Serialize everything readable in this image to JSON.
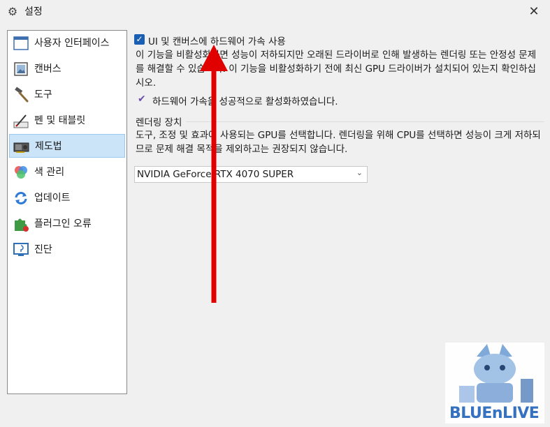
{
  "window": {
    "title": "설정",
    "close_glyph": "✕",
    "settings_icon": "gear-icon"
  },
  "sidebar": {
    "items": [
      {
        "label": "사용자 인터페이스",
        "icon": "window-icon",
        "selected": false
      },
      {
        "label": "캔버스",
        "icon": "image-icon",
        "selected": false
      },
      {
        "label": "도구",
        "icon": "hammer-icon",
        "selected": false
      },
      {
        "label": "펜 및 태블릿",
        "icon": "tablet-pen-icon",
        "selected": false
      },
      {
        "label": "제도법",
        "icon": "gpu-card-icon",
        "selected": true
      },
      {
        "label": "색 관리",
        "icon": "color-circles-icon",
        "selected": false
      },
      {
        "label": "업데이트",
        "icon": "refresh-icon",
        "selected": false
      },
      {
        "label": "플러그인 오류",
        "icon": "puzzle-icon",
        "selected": false
      },
      {
        "label": "진단",
        "icon": "diagnostics-icon",
        "selected": false
      }
    ]
  },
  "main": {
    "hw_accel": {
      "checked": true,
      "label": "UI 및 캔버스에 하드웨어 가속 사용",
      "description": "이 기능을 비활성화하면 성능이 저하되지만 오래된 드라이버로 인해 발생하는 렌더링 또는 안정성 문제를 해결할 수 있습니다. 이 기능을 비활성화하기 전에 최신 GPU 드라이버가 설치되어 있는지 확인하십시오.",
      "status": "하드웨어 가속을 성공적으로 활성화하였습니다."
    },
    "rendering": {
      "heading": "렌더링 장치",
      "description": "도구, 조정 및 효과에 사용되는 GPU를 선택합니다. 렌더링을 위해 CPU를 선택하면 성능이 크게 저하되므로 문제 해결 목적을 제외하고는 권장되지 않습니다.",
      "selected_device": "NVIDIA GeForce RTX 4070 SUPER"
    }
  },
  "watermark": {
    "text": "BLUEnLIVE"
  },
  "colors": {
    "accent": "#1a5fb4",
    "selected_bg": "#cce4f7",
    "arrow": "#e00000"
  }
}
